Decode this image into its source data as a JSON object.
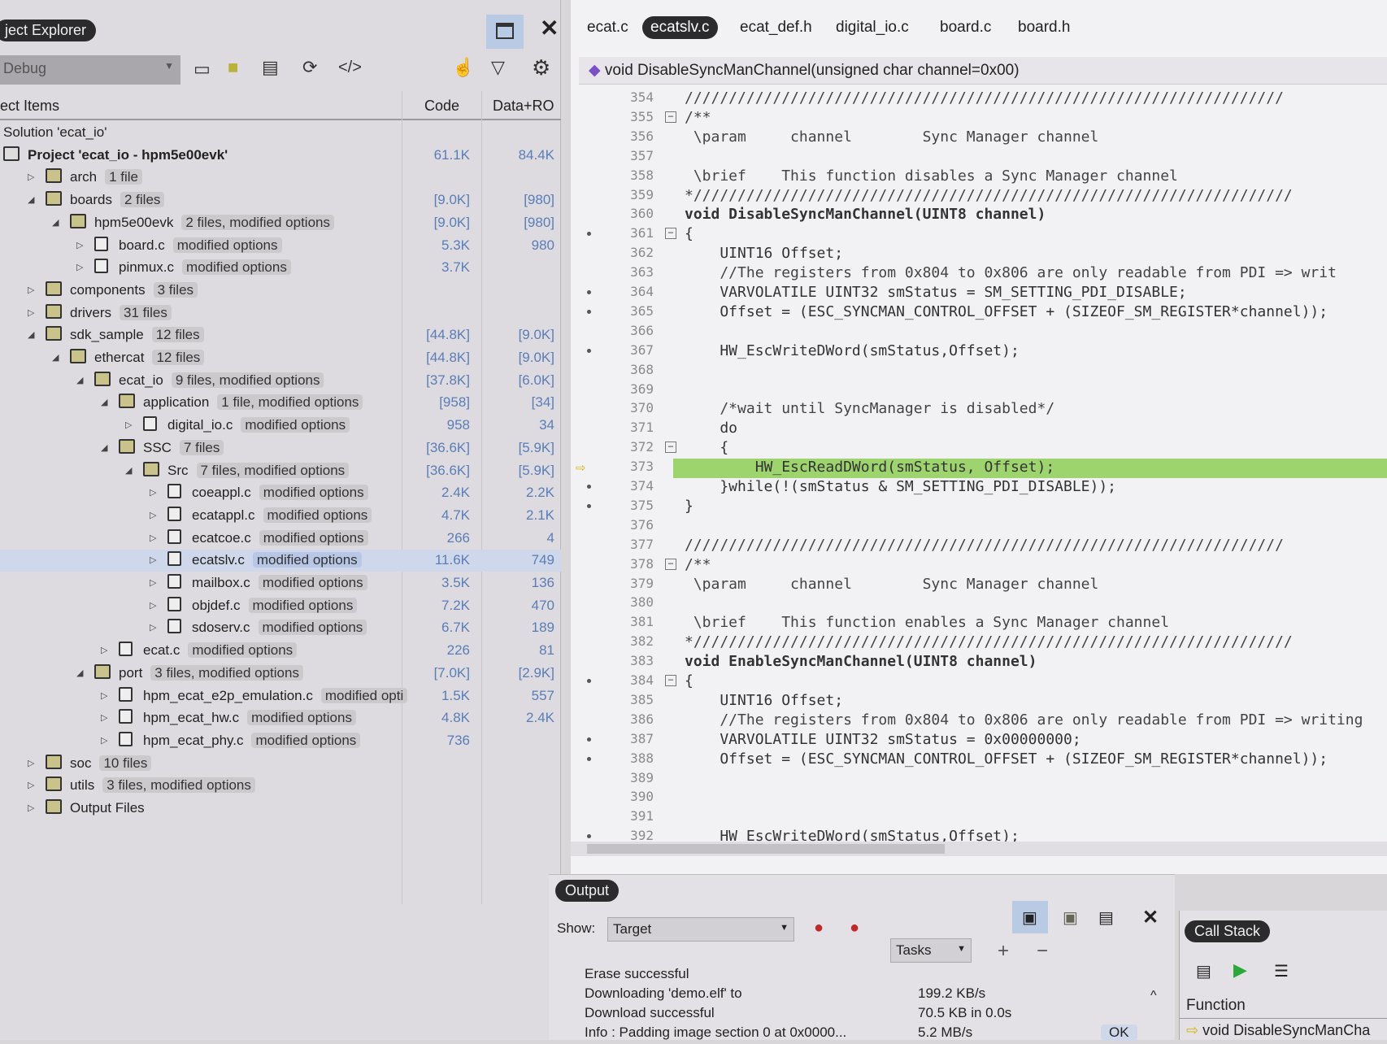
{
  "explorer": {
    "title": "ject Explorer",
    "config": "Debug",
    "col_items": "ect Items",
    "col_code": "Code",
    "col_data": "Data+RO",
    "rows": [
      {
        "name": "Solution 'ecat_io'",
        "note": "",
        "code": "",
        "data": "",
        "depth": 0,
        "exp": "",
        "icon": ""
      },
      {
        "name": "Project 'ecat_io - hpm5e00evk'",
        "note": "",
        "code": "61.1K",
        "data": "84.4K",
        "depth": 0,
        "exp": "",
        "icon": "proj",
        "bold": true
      },
      {
        "name": "arch",
        "note": "1 file",
        "code": "",
        "data": "",
        "depth": 1,
        "exp": "c",
        "icon": "folder"
      },
      {
        "name": "boards",
        "note": "2 files",
        "code": "[9.0K]",
        "data": "[980]",
        "depth": 1,
        "exp": "e",
        "icon": "folder"
      },
      {
        "name": "hpm5e00evk",
        "note": "2 files, modified options",
        "code": "[9.0K]",
        "data": "[980]",
        "depth": 2,
        "exp": "e",
        "icon": "folder"
      },
      {
        "name": "board.c",
        "note": "modified options",
        "code": "5.3K",
        "data": "980",
        "depth": 3,
        "exp": "c",
        "icon": "file"
      },
      {
        "name": "pinmux.c",
        "note": "modified options",
        "code": "3.7K",
        "data": "",
        "depth": 3,
        "exp": "c",
        "icon": "file"
      },
      {
        "name": "components",
        "note": "3 files",
        "code": "",
        "data": "",
        "depth": 1,
        "exp": "c",
        "icon": "folder"
      },
      {
        "name": "drivers",
        "note": "31 files",
        "code": "",
        "data": "",
        "depth": 1,
        "exp": "c",
        "icon": "folder"
      },
      {
        "name": "sdk_sample",
        "note": "12 files",
        "code": "[44.8K]",
        "data": "[9.0K]",
        "depth": 1,
        "exp": "e",
        "icon": "folder"
      },
      {
        "name": "ethercat",
        "note": "12 files",
        "code": "[44.8K]",
        "data": "[9.0K]",
        "depth": 2,
        "exp": "e",
        "icon": "folder"
      },
      {
        "name": "ecat_io",
        "note": "9 files, modified options",
        "code": "[37.8K]",
        "data": "[6.0K]",
        "depth": 3,
        "exp": "e",
        "icon": "folder"
      },
      {
        "name": "application",
        "note": "1 file, modified options",
        "code": "[958]",
        "data": "[34]",
        "depth": 4,
        "exp": "e",
        "icon": "folder"
      },
      {
        "name": "digital_io.c",
        "note": "modified options",
        "code": "958",
        "data": "34",
        "depth": 5,
        "exp": "c",
        "icon": "file"
      },
      {
        "name": "SSC",
        "note": "7 files",
        "code": "[36.6K]",
        "data": "[5.9K]",
        "depth": 4,
        "exp": "e",
        "icon": "folder"
      },
      {
        "name": "Src",
        "note": "7 files, modified options",
        "code": "[36.6K]",
        "data": "[5.9K]",
        "depth": 5,
        "exp": "e",
        "icon": "folder"
      },
      {
        "name": "coeappl.c",
        "note": "modified options",
        "code": "2.4K",
        "data": "2.2K",
        "depth": 6,
        "exp": "c",
        "icon": "file"
      },
      {
        "name": "ecatappl.c",
        "note": "modified options",
        "code": "4.7K",
        "data": "2.1K",
        "depth": 6,
        "exp": "c",
        "icon": "file"
      },
      {
        "name": "ecatcoe.c",
        "note": "modified options",
        "code": "266",
        "data": "4",
        "depth": 6,
        "exp": "c",
        "icon": "file"
      },
      {
        "name": "ecatslv.c",
        "note": "modified options",
        "code": "11.6K",
        "data": "749",
        "depth": 6,
        "exp": "c",
        "icon": "file",
        "selected": true
      },
      {
        "name": "mailbox.c",
        "note": "modified options",
        "code": "3.5K",
        "data": "136",
        "depth": 6,
        "exp": "c",
        "icon": "file"
      },
      {
        "name": "objdef.c",
        "note": "modified options",
        "code": "7.2K",
        "data": "470",
        "depth": 6,
        "exp": "c",
        "icon": "file"
      },
      {
        "name": "sdoserv.c",
        "note": "modified options",
        "code": "6.7K",
        "data": "189",
        "depth": 6,
        "exp": "c",
        "icon": "file"
      },
      {
        "name": "ecat.c",
        "note": "modified options",
        "code": "226",
        "data": "81",
        "depth": 4,
        "exp": "c",
        "icon": "file"
      },
      {
        "name": "port",
        "note": "3 files, modified options",
        "code": "[7.0K]",
        "data": "[2.9K]",
        "depth": 3,
        "exp": "e",
        "icon": "folder"
      },
      {
        "name": "hpm_ecat_e2p_emulation.c",
        "note": "modified opti",
        "code": "1.5K",
        "data": "557",
        "depth": 4,
        "exp": "c",
        "icon": "file"
      },
      {
        "name": "hpm_ecat_hw.c",
        "note": "modified options",
        "code": "4.8K",
        "data": "2.4K",
        "depth": 4,
        "exp": "c",
        "icon": "file"
      },
      {
        "name": "hpm_ecat_phy.c",
        "note": "modified options",
        "code": "736",
        "data": "",
        "depth": 4,
        "exp": "c",
        "icon": "file"
      },
      {
        "name": "soc",
        "note": "10 files",
        "code": "",
        "data": "",
        "depth": 1,
        "exp": "c",
        "icon": "folder"
      },
      {
        "name": "utils",
        "note": "3 files, modified options",
        "code": "",
        "data": "",
        "depth": 1,
        "exp": "c",
        "icon": "folder"
      },
      {
        "name": "Output Files",
        "note": "",
        "code": "",
        "data": "",
        "depth": 1,
        "exp": "c",
        "icon": "folder"
      }
    ]
  },
  "editor": {
    "tabs": [
      "ecat.c",
      "ecatslv.c",
      "ecat_def.h",
      "digital_io.c",
      "board.c",
      "board.h"
    ],
    "active_tab": 1,
    "function": "void DisableSyncManChannel(unsigned char channel=0x00)",
    "lines": [
      {
        "n": "354",
        "t": "////////////////////////////////////////////////////////////////////"
      },
      {
        "n": "355",
        "t": "/**",
        "fold": true
      },
      {
        "n": "356",
        "t": " \\param     channel        Sync Manager channel"
      },
      {
        "n": "357",
        "t": ""
      },
      {
        "n": "358",
        "t": " \\brief    This function disables a Sync Manager channel"
      },
      {
        "n": "359",
        "t": "*////////////////////////////////////////////////////////////////////"
      },
      {
        "n": "360",
        "t": "void DisableSyncManChannel(UINT8 channel)"
      },
      {
        "n": "361",
        "t": "{",
        "fold": true,
        "bp": true
      },
      {
        "n": "362",
        "t": "    UINT16 Offset;"
      },
      {
        "n": "363",
        "t": "    //The registers from 0x804 to 0x806 are only readable from PDI => writ"
      },
      {
        "n": "364",
        "t": "    VARVOLATILE UINT32 smStatus = SM_SETTING_PDI_DISABLE;",
        "bp": true
      },
      {
        "n": "365",
        "t": "    Offset = (ESC_SYNCMAN_CONTROL_OFFSET + (SIZEOF_SM_REGISTER*channel));",
        "bp": true
      },
      {
        "n": "366",
        "t": ""
      },
      {
        "n": "367",
        "t": "    HW_EscWriteDWord(smStatus,Offset);",
        "bp": true
      },
      {
        "n": "368",
        "t": ""
      },
      {
        "n": "369",
        "t": ""
      },
      {
        "n": "370",
        "t": "    /*wait until SyncManager is disabled*/"
      },
      {
        "n": "371",
        "t": "    do"
      },
      {
        "n": "372",
        "t": "    {",
        "fold": true
      },
      {
        "n": "373",
        "t": "        HW_EscReadDWord(smStatus, Offset);",
        "current": true
      },
      {
        "n": "374",
        "t": "    }while(!(smStatus & SM_SETTING_PDI_DISABLE));",
        "bp": true
      },
      {
        "n": "375",
        "t": "}",
        "bp": true
      },
      {
        "n": "376",
        "t": ""
      },
      {
        "n": "377",
        "t": "////////////////////////////////////////////////////////////////////"
      },
      {
        "n": "378",
        "t": "/**",
        "fold": true
      },
      {
        "n": "379",
        "t": " \\param     channel        Sync Manager channel"
      },
      {
        "n": "380",
        "t": ""
      },
      {
        "n": "381",
        "t": " \\brief    This function enables a Sync Manager channel"
      },
      {
        "n": "382",
        "t": "*////////////////////////////////////////////////////////////////////"
      },
      {
        "n": "383",
        "t": "void EnableSyncManChannel(UINT8 channel)"
      },
      {
        "n": "384",
        "t": "{",
        "fold": true,
        "bp": true
      },
      {
        "n": "385",
        "t": "    UINT16 Offset;"
      },
      {
        "n": "386",
        "t": "    //The registers from 0x804 to 0x806 are only readable from PDI => writing"
      },
      {
        "n": "387",
        "t": "    VARVOLATILE UINT32 smStatus = 0x00000000;",
        "bp": true
      },
      {
        "n": "388",
        "t": "    Offset = (ESC_SYNCMAN_CONTROL_OFFSET + (SIZEOF_SM_REGISTER*channel));",
        "bp": true
      },
      {
        "n": "389",
        "t": ""
      },
      {
        "n": "390",
        "t": ""
      },
      {
        "n": "391",
        "t": ""
      },
      {
        "n": "392",
        "t": "    HW_EscWriteDWord(smStatus,Offset);",
        "bp": true
      }
    ]
  },
  "output": {
    "title": "Output",
    "show_label": "Show:",
    "show_value": "Target",
    "tasks_value": "Tasks",
    "entries": [
      {
        "text": "Erase successful",
        "detail": "",
        "status": ""
      },
      {
        "text": "Downloading 'demo.elf' to",
        "detail": "199.2 KB/s",
        "status": ""
      },
      {
        "text": "Download successful",
        "detail": "70.5 KB in 0.0s",
        "status": ""
      },
      {
        "text": "Info : Padding image section 0 at 0x0000...",
        "detail": "5.2 MB/s",
        "status": "OK"
      }
    ]
  },
  "callstack": {
    "title": "Call Stack",
    "col_function": "Function",
    "frames": [
      "void DisableSyncManCha"
    ]
  }
}
